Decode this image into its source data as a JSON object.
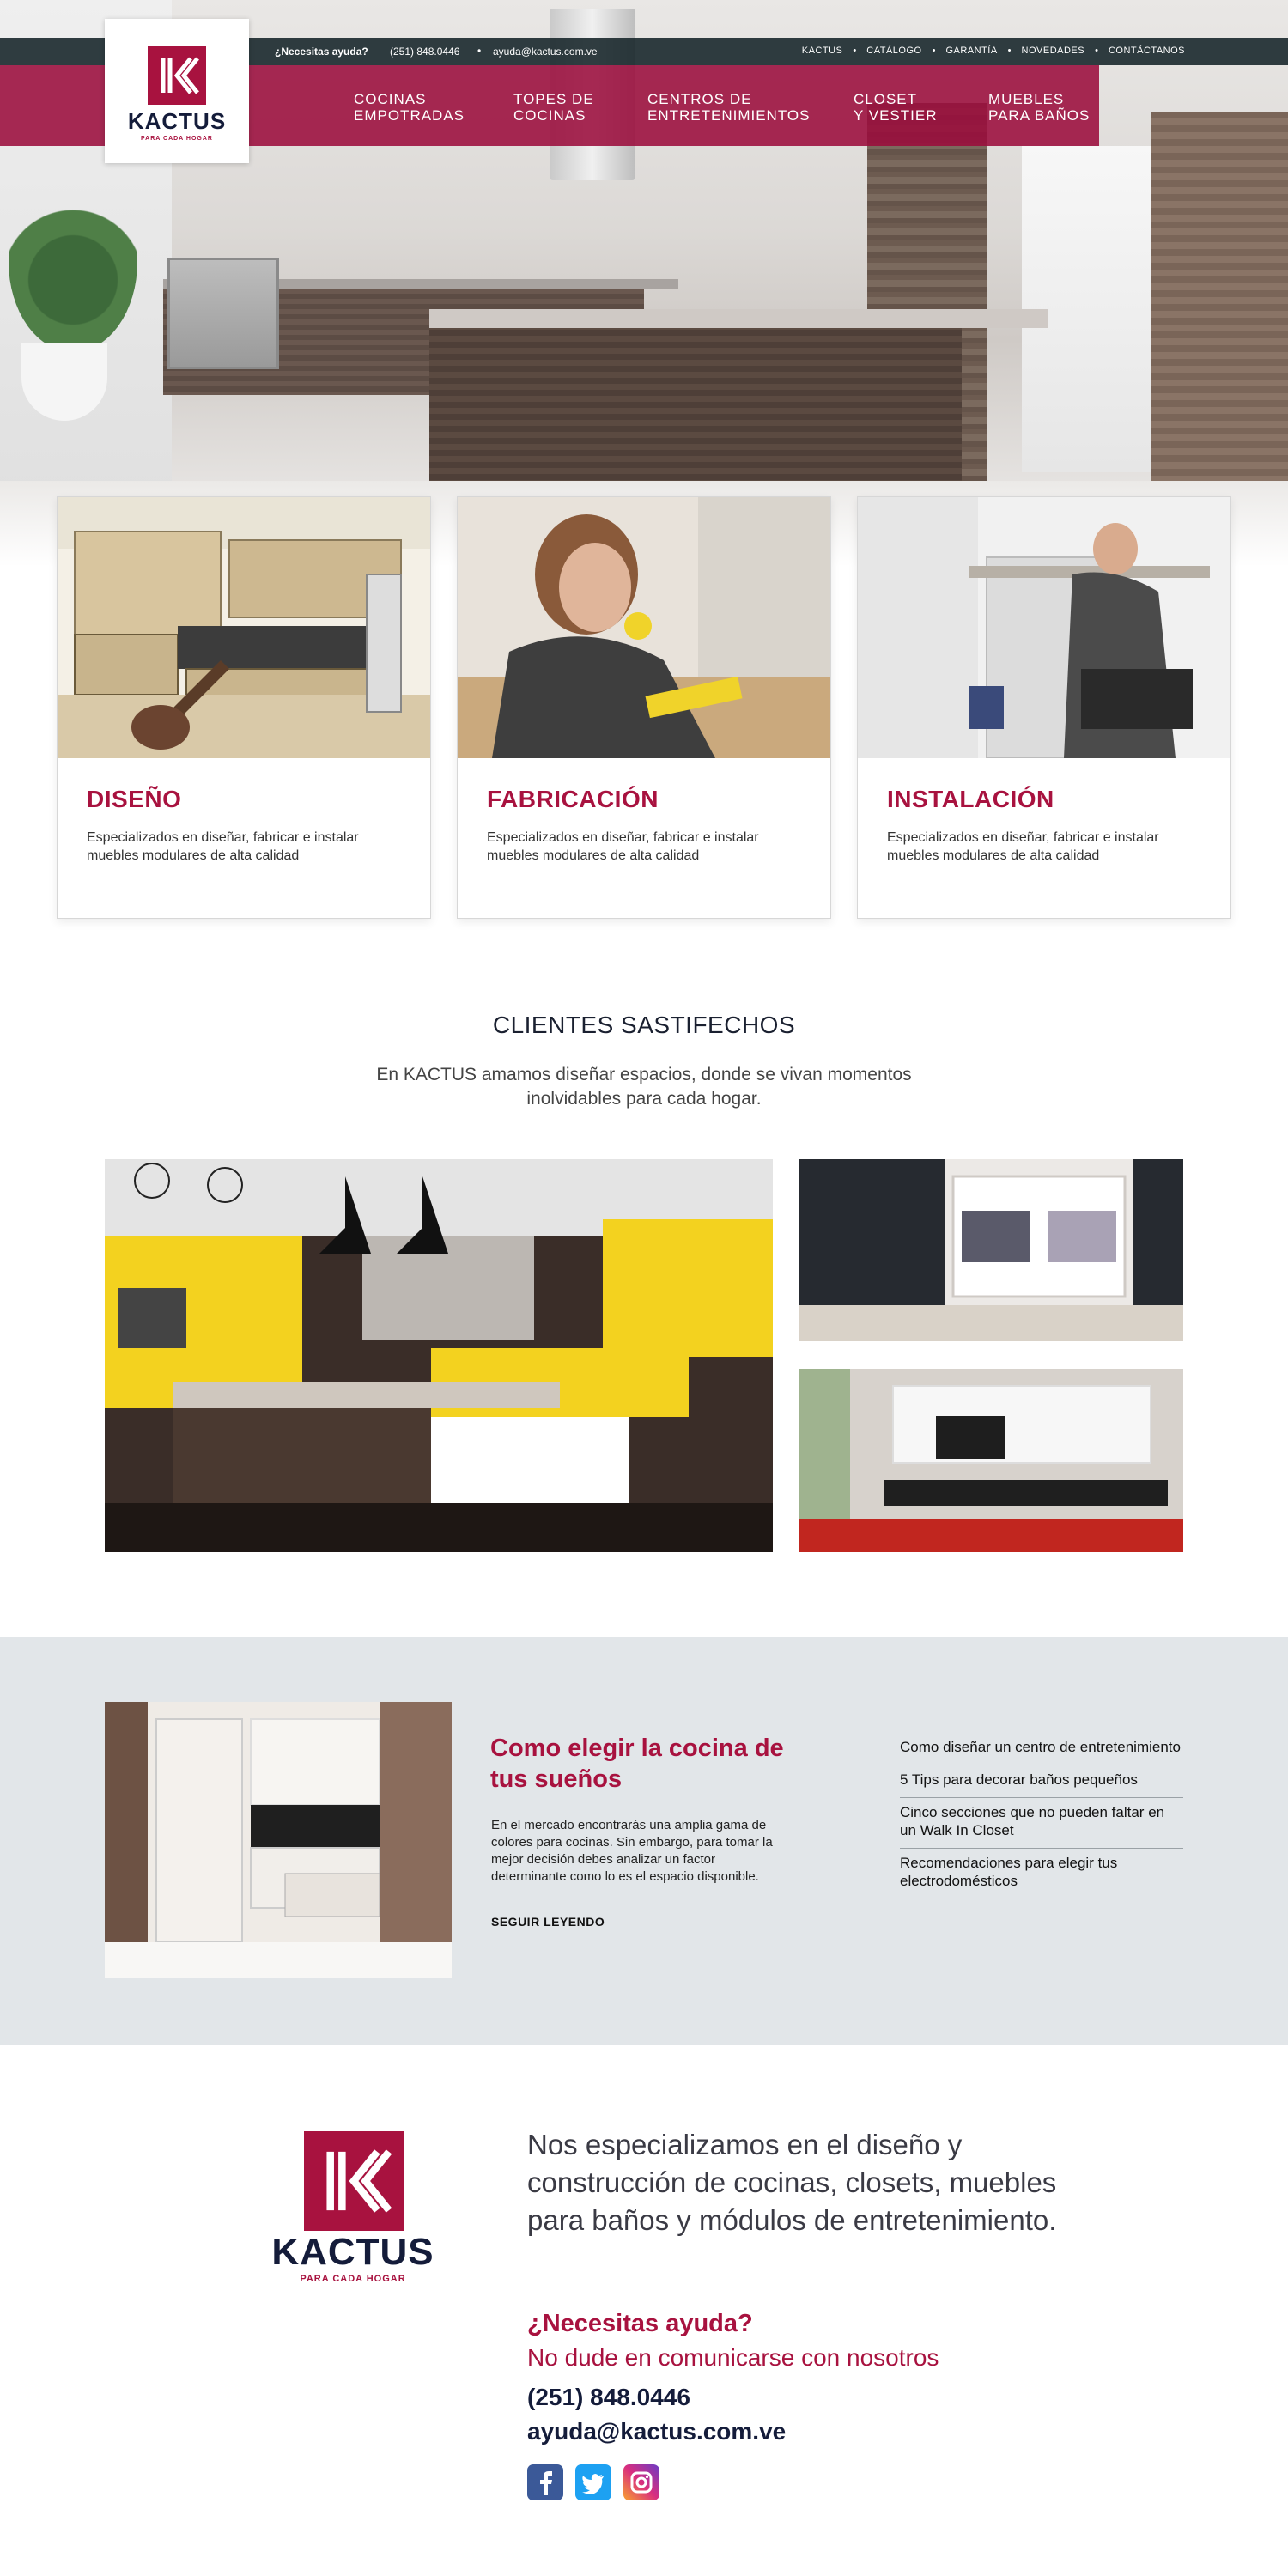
{
  "topbar": {
    "help_label": "¿Necesitas ayuda?",
    "phone": "(251) 848.0446",
    "separator": "•",
    "email": "ayuda@kactus.com.ve",
    "links": [
      "KACTUS",
      "CATÁLOGO",
      "GARANTÍA",
      "NOVEDADES",
      "CONTÁCTANOS"
    ]
  },
  "brand": {
    "name": "KACTUS",
    "tagline": "PARA CADA HOGAR",
    "accent_color": "#a8123f",
    "navy_color": "#141c3a"
  },
  "nav": {
    "items": [
      {
        "line1": "COCINAS",
        "line2": "EMPOTRADAS"
      },
      {
        "line1": "TOPES DE",
        "line2": "COCINAS"
      },
      {
        "line1": "CENTROS DE",
        "line2": "ENTRETENIMIENTOS"
      },
      {
        "line1": "CLOSET",
        "line2": "Y VESTIER"
      },
      {
        "line1": "MUEBLES",
        "line2": "PARA BAÑOS"
      }
    ]
  },
  "services": [
    {
      "title": "DISEÑO",
      "description": "Especializados en diseñar, fabricar e instalar muebles modulares de alta calidad"
    },
    {
      "title": "FABRICACIÓN",
      "description": "Especializados en diseñar, fabricar e instalar muebles modulares de alta calidad"
    },
    {
      "title": "INSTALACIÓN",
      "description": "Especializados en diseñar, fabricar e instalar muebles modulares de alta calidad"
    }
  ],
  "clients": {
    "title": "CLIENTES SASTIFECHOS",
    "subtitle": "En KACTUS amamos diseñar espacios, donde se vivan momentos inolvidables para cada hogar."
  },
  "blog": {
    "title": "Como elegir la cocina de tus sueños",
    "excerpt": "En el mercado encontrarás una amplia gama de colores para cocinas. Sin embargo, para tomar la mejor decisión debes analizar un factor determinante como lo es el espacio disponible.",
    "read_more": "SEGUIR LEYENDO",
    "related": [
      "Como diseñar un centro de entretenimiento",
      "5 Tips para decorar baños pequeños",
      "Cinco secciones que no pueden faltar en un Walk In Closet",
      "Recomendaciones para elegir tus electrodomésticos"
    ]
  },
  "footer": {
    "about": "Nos especializamos en el diseño y construcción de cocinas, closets, muebles para baños y módulos de entretenimiento.",
    "help": "¿Necesitas ayuda?",
    "contact_line": "No dude en comunicarse con nosotros",
    "phone": "(251) 848.0446",
    "email": "ayuda@kactus.com.ve",
    "social": [
      {
        "icon": "facebook-icon",
        "color": "#3b5998"
      },
      {
        "icon": "twitter-icon",
        "color": "#1da1f2"
      },
      {
        "icon": "instagram-icon",
        "color": "#c13584"
      }
    ]
  }
}
